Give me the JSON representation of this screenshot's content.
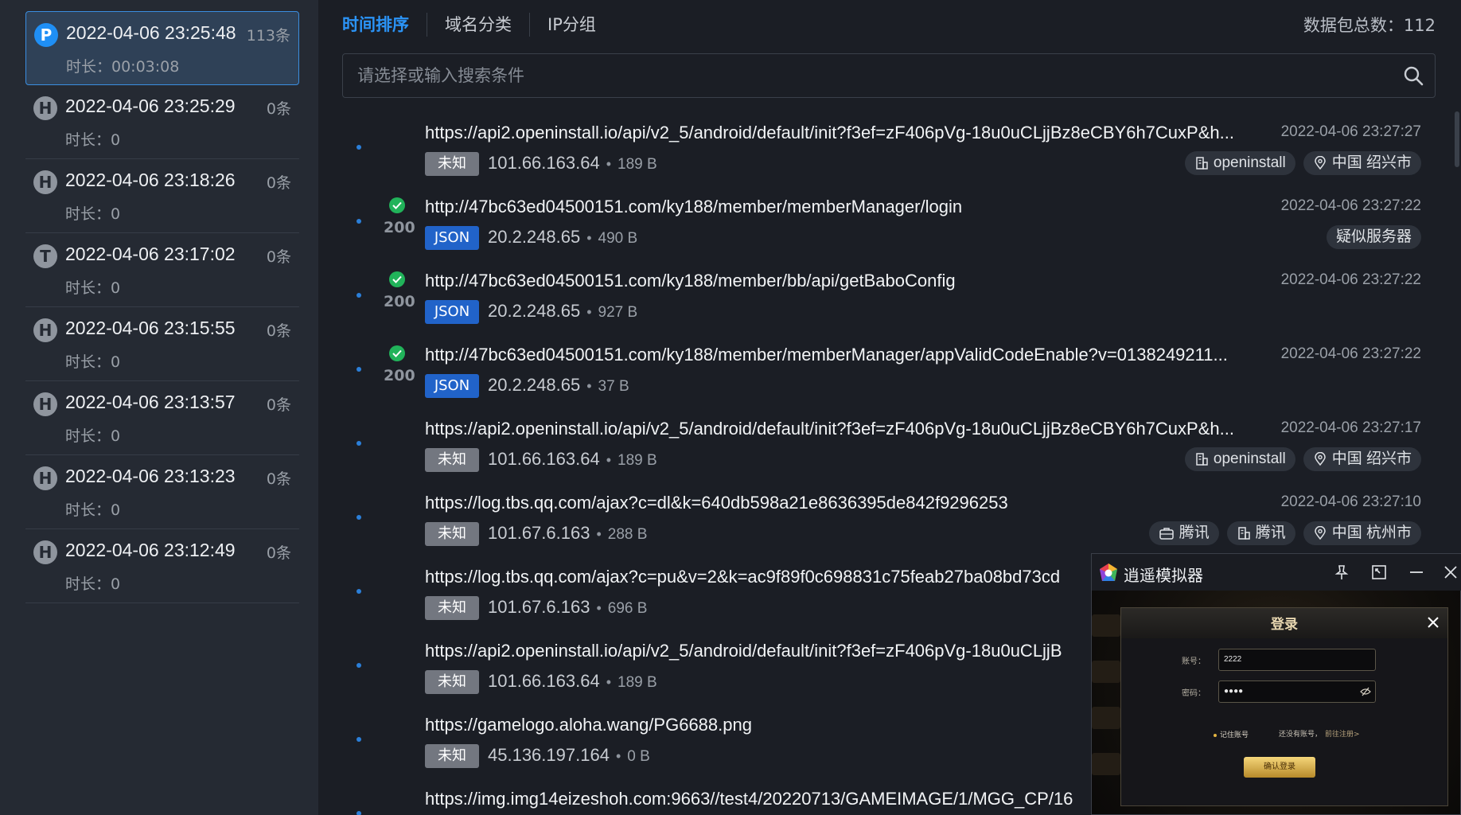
{
  "sessions": [
    {
      "letter": "P",
      "time": "2022-04-06 23:25:48",
      "count": "113条",
      "duration": "时长：00:03:08",
      "active": true
    },
    {
      "letter": "H",
      "time": "2022-04-06 23:25:29",
      "count": "0条",
      "duration": "时长：0"
    },
    {
      "letter": "H",
      "time": "2022-04-06 23:18:26",
      "count": "0条",
      "duration": "时长：0"
    },
    {
      "letter": "T",
      "time": "2022-04-06 23:17:02",
      "count": "0条",
      "duration": "时长：0"
    },
    {
      "letter": "H",
      "time": "2022-04-06 23:15:55",
      "count": "0条",
      "duration": "时长：0"
    },
    {
      "letter": "H",
      "time": "2022-04-06 23:13:57",
      "count": "0条",
      "duration": "时长：0"
    },
    {
      "letter": "H",
      "time": "2022-04-06 23:13:23",
      "count": "0条",
      "duration": "时长：0"
    },
    {
      "letter": "H",
      "time": "2022-04-06 23:12:49",
      "count": "0条",
      "duration": "时长：0"
    }
  ],
  "tabs": [
    {
      "label": "时间排序",
      "active": true
    },
    {
      "label": "域名分类"
    },
    {
      "label": "IP分组"
    }
  ],
  "total": "数据包总数：112",
  "search": {
    "placeholder": "请选择或输入搜索条件"
  },
  "requests": [
    {
      "url": "https://api2.openinstall.io/api/v2_5/android/default/init?f3ef=zF406pVg-18u0uCLjjBz8eCBY6h7CuxP&h...",
      "time": "2022-04-06 23:27:27",
      "type": "未知",
      "type_class": "unknown",
      "ip": "101.66.163.64",
      "size": "189 B",
      "status": "",
      "tags": [
        "openinstall",
        "中国 绍兴市"
      ],
      "tag_icons": [
        "building-icon",
        "location-icon"
      ]
    },
    {
      "url": "http://47bc63ed04500151.com/ky188/member/memberManager/login",
      "time": "2022-04-06 23:27:22",
      "type": "JSON",
      "type_class": "json",
      "ip": "20.2.248.65",
      "size": "490 B",
      "status": "200",
      "tags": [
        "疑似服务器"
      ],
      "tag_icons": [
        ""
      ]
    },
    {
      "url": "http://47bc63ed04500151.com/ky188/member/bb/api/getBaboConfig",
      "time": "2022-04-06 23:27:22",
      "type": "JSON",
      "type_class": "json",
      "ip": "20.2.248.65",
      "size": "927 B",
      "status": "200",
      "tags": [],
      "tag_icons": []
    },
    {
      "url": "http://47bc63ed04500151.com/ky188/member/memberManager/appValidCodeEnable?v=0138249211...",
      "time": "2022-04-06 23:27:22",
      "type": "JSON",
      "type_class": "json",
      "ip": "20.2.248.65",
      "size": "37 B",
      "status": "200",
      "tags": [],
      "tag_icons": []
    },
    {
      "url": "https://api2.openinstall.io/api/v2_5/android/default/init?f3ef=zF406pVg-18u0uCLjjBz8eCBY6h7CuxP&h...",
      "time": "2022-04-06 23:27:17",
      "type": "未知",
      "type_class": "unknown",
      "ip": "101.66.163.64",
      "size": "189 B",
      "status": "",
      "tags": [
        "openinstall",
        "中国 绍兴市"
      ],
      "tag_icons": [
        "building-icon",
        "location-icon"
      ]
    },
    {
      "url": "https://log.tbs.qq.com/ajax?c=dl&k=640db598a21e8636395de842f9296253",
      "time": "2022-04-06 23:27:10",
      "type": "未知",
      "type_class": "unknown",
      "ip": "101.67.6.163",
      "size": "288 B",
      "status": "",
      "tags": [
        "腾讯",
        "腾讯",
        "中国 杭州市"
      ],
      "tag_icons": [
        "briefcase-icon",
        "building-icon",
        "location-icon"
      ]
    },
    {
      "url": "https://log.tbs.qq.com/ajax?c=pu&v=2&k=ac9f89f0c698831c75feab27ba08bd73cd",
      "time": "",
      "type": "未知",
      "type_class": "unknown",
      "ip": "101.67.6.163",
      "size": "696 B",
      "status": "",
      "tags": [],
      "tag_icons": []
    },
    {
      "url": "https://api2.openinstall.io/api/v2_5/android/default/init?f3ef=zF406pVg-18u0uCLjjB",
      "time": "",
      "type": "未知",
      "type_class": "unknown",
      "ip": "101.66.163.64",
      "size": "189 B",
      "status": "",
      "tags": [],
      "tag_icons": []
    },
    {
      "url": "https://gamelogo.aloha.wang/PG6688.png",
      "time": "",
      "type": "未知",
      "type_class": "unknown",
      "ip": "45.136.197.164",
      "size": "0 B",
      "status": "",
      "tags": [],
      "tag_icons": []
    },
    {
      "url": "https://img.img14eizeshoh.com:9663//test4/20220713/GAMEIMAGE/1/MGG_CP/16",
      "time": "",
      "type": "",
      "type_class": "",
      "ip": "",
      "size": "",
      "status": "",
      "tags": [],
      "tag_icons": []
    }
  ],
  "emulator": {
    "title": "逍遥模拟器",
    "dialog_title": "登录",
    "account_label": "账号：",
    "account_value": "2222",
    "password_label": "密码：",
    "password_value": "●●●●",
    "remember": "记住账号",
    "no_account": "还没有账号，",
    "register": "前往注册>",
    "submit": "确认登录"
  },
  "colors": {
    "accent": "#2b94f7",
    "json_badge": "#2163c9",
    "unknown_badge": "#737780",
    "success": "#21b35a"
  }
}
